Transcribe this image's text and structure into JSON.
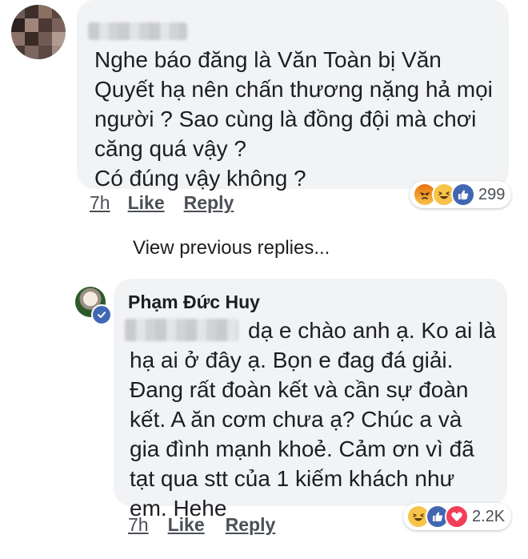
{
  "comment": {
    "text": "Nghe báo đăng là Văn Toàn bị Văn\nQuyết hạ nên chấn thương nặng hả mọi\nngười ?  Sao cùng là đồng đội mà chơi\ncăng quá vậy ?\nCó đúng vậy không ?",
    "time": "7h",
    "like_label": "Like",
    "reply_label": "Reply",
    "reactions": [
      "angry-icon",
      "haha-icon",
      "like-icon"
    ],
    "reaction_count": "299"
  },
  "view_previous_replies": "View previous replies...",
  "reply": {
    "author": "Phạm Đức Huy",
    "text": "dạ e chào anh ạ. Ko ai là\nhạ ai ở đây ạ. Bọn e đag đá giải.\nĐang rất đoàn kết và cần sự đoàn\nkết. A ăn cơm chưa ạ? Chúc a và\ngia đình mạnh khoẻ. Cảm ơn vì đã\ntạt qua stt của 1 kiếm khách như\nem. Hehe",
    "time": "7h",
    "like_label": "Like",
    "reply_label": "Reply",
    "reactions": [
      "haha-icon",
      "like-icon",
      "love-icon"
    ],
    "reaction_count": "2.2K"
  },
  "colors": {
    "bubble": "#f2f3f5",
    "text": "#1c1e21",
    "meta": "#4b4f56",
    "like_blue": "#4267b2",
    "love_red": "#f33e58",
    "emoji_yellow": "#f7c34a",
    "angry_orange": "#e9710f"
  }
}
